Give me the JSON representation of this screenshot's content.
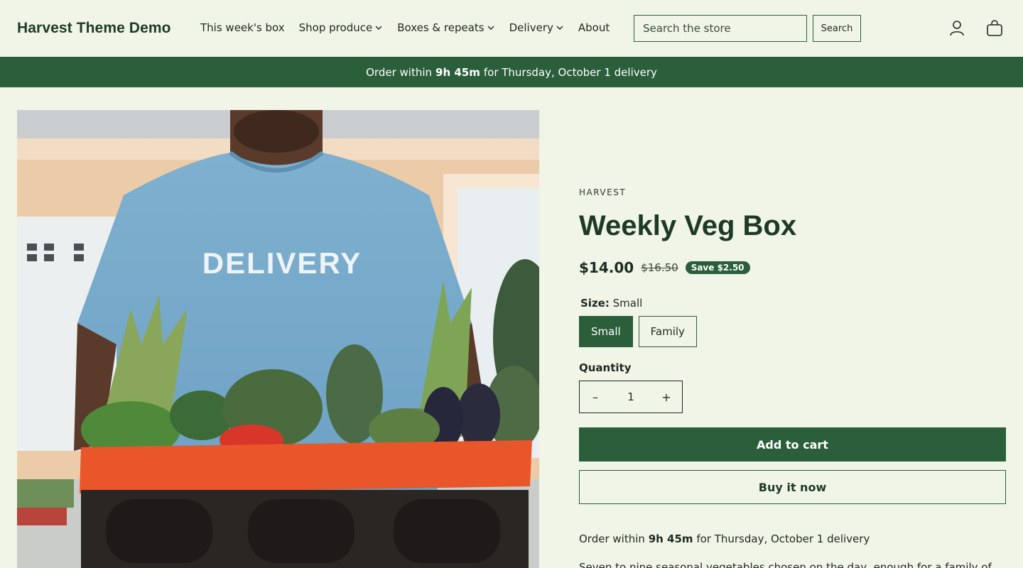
{
  "header": {
    "logo": "Harvest Theme Demo",
    "nav": [
      {
        "label": "This week's box",
        "dropdown": false
      },
      {
        "label": "Shop produce",
        "dropdown": true
      },
      {
        "label": "Boxes & repeats",
        "dropdown": true
      },
      {
        "label": "Delivery",
        "dropdown": true
      },
      {
        "label": "About",
        "dropdown": false
      }
    ],
    "search_placeholder": "Search the store",
    "search_button": "Search",
    "icons": [
      "account-icon",
      "cart-icon"
    ]
  },
  "announcement": {
    "prefix": "Order within",
    "time": "9h 45m",
    "suffix": "for Thursday, October 1 delivery"
  },
  "product": {
    "vendor": "HARVEST",
    "title": "Weekly Veg Box",
    "price": "$14.00",
    "compare_price": "$16.50",
    "save_badge": "Save $2.50",
    "size_label": "Size:",
    "size_value": "Small",
    "sizes": [
      "Small",
      "Family"
    ],
    "quantity_label": "Quantity",
    "quantity": "1",
    "minus": "–",
    "plus": "+",
    "add_to_cart": "Add to cart",
    "buy_now": "Buy it now",
    "order_note_prefix": "Order within",
    "order_note_time": "9h 45m",
    "order_note_suffix": "for Thursday, October 1 delivery",
    "description": "Seven to nine seasonal vegetables chosen on the day, enough for a family of"
  },
  "image": {
    "shirt_text": "DELIVERY"
  },
  "colors": {
    "background": "#f0f5e8",
    "brand_green": "#2b5e3a",
    "crate_orange": "#e8562a"
  }
}
